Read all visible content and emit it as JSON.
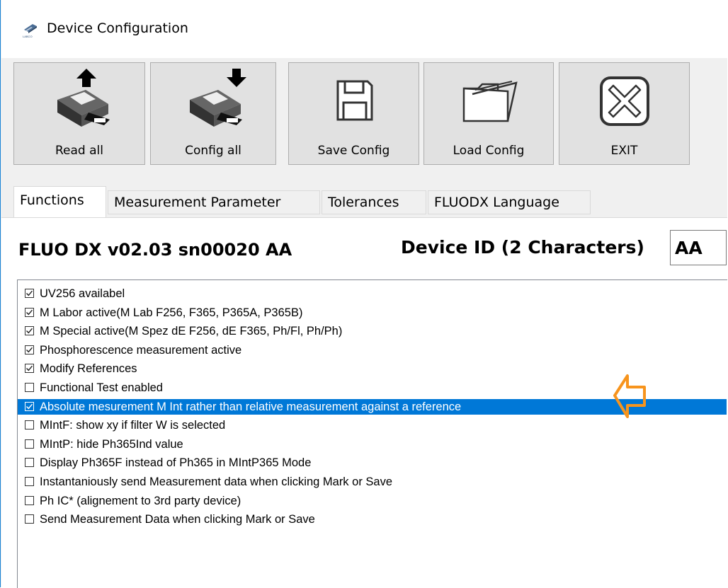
{
  "window": {
    "title": "Device Configuration"
  },
  "toolbar": {
    "read_all": "Read all",
    "config_all": "Config all",
    "save_config": "Save Config",
    "load_config": "Load Config",
    "exit": "EXIT"
  },
  "tabs": [
    {
      "label": "Functions",
      "active": true
    },
    {
      "label": "Measurement Parameter",
      "active": false
    },
    {
      "label": "Tolerances",
      "active": false
    },
    {
      "label": "FLUODX Language",
      "active": false
    }
  ],
  "device": {
    "info": "FLUO DX v02.03 sn00020 AA",
    "id_label": "Device ID (2 Characters)",
    "id_value": "AA"
  },
  "options": [
    {
      "label": "UV256 availabel",
      "checked": true
    },
    {
      "label": "M Labor active(M Lab F256, F365, P365A, P365B)",
      "checked": true
    },
    {
      "label": "M Special active(M Spez dE F256, dE F365, Ph/Fl, Ph/Ph)",
      "checked": true
    },
    {
      "label": "Phosphorescence measurement active",
      "checked": true
    },
    {
      "label": "Modify References",
      "checked": true
    },
    {
      "label": "Functional Test enabled",
      "checked": false
    },
    {
      "label": "Absolute mesurement M Int rather than relative measurement against a reference",
      "checked": true,
      "selected": true
    },
    {
      "label": "MIntF: show xy if filter W is selected",
      "checked": false
    },
    {
      "label": "MIntP: hide Ph365Ind value",
      "checked": false
    },
    {
      "label": "Display Ph365F instead of Ph365 in MIntP365 Mode",
      "checked": false
    },
    {
      "label": "Instantaniously send Measurement data when clicking Mark or Save",
      "checked": false
    },
    {
      "label": "Ph IC* (alignement to 3rd party device)",
      "checked": false
    },
    {
      "label": "Send Measurement Data when clicking Mark or Save",
      "checked": false
    }
  ],
  "colors": {
    "selection": "#0078d7",
    "annotation_arrow": "#f7941d",
    "window_border": "#1883d7"
  }
}
